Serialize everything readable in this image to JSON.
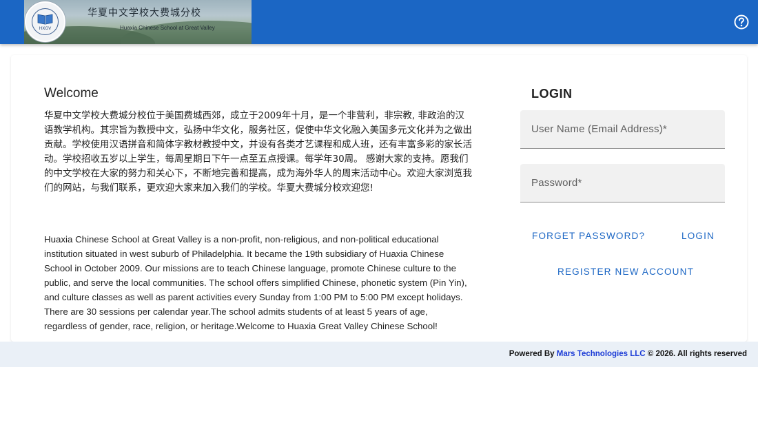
{
  "header": {
    "banner_cn_title": "华夏中文学校大费城分校",
    "banner_en_title": "Huaxia Chinese School at Great Valley",
    "seal_code": "HXGV",
    "help_icon": "help-circle-icon",
    "colors": {
      "appbar": "#1b66c4"
    }
  },
  "welcome": {
    "title": "Welcome",
    "zh_paragraph": "华夏中文学校大费城分校位于美国费城西郊，成立于2009年十月，是一个非营利，非宗教, 非政治的汉语教学机构。其宗旨为教授中文，弘扬中华文化，服务社区，促使中华文化融入美国多元文化并为之做出贡献。学校使用汉语拼音和简体字教材教授中文，并设有各类才艺课程和成人班，还有丰富多彩的家长活动。学校招收五岁以上学生，每周星期日下午一点至五点授课。每学年30周。 感谢大家的支持。愿我们的中文学校在大家的努力和关心下，不断地完善和提高，成为海外华人的周末活动中心。欢迎大家浏览我们的网站，与我们联系，更欢迎大家来加入我们的学校。华夏大费城分校欢迎您!",
    "en_paragraph": "Huaxia Chinese School at Great Valley is a non-profit, non-religious, and non-political educational institution situated in west suburb of Philadelphia. It became the 19th subsidiary of Huaxia Chinese School in October 2009. Our missions are to teach Chinese language, promote Chinese culture to the public, and serve the local communities. The school offers simplified Chinese, phonetic system (Pin Yin), and culture classes as well as parent activities every Sunday from 1:00 PM to 5:00 PM except holidays. There are 30 sessions per calendar year.The school admits students of at least 5 years of age, regardless of gender, race, religion, or heritage.Welcome to Huaxia Great Valley Chinese School!"
  },
  "login": {
    "title": "LOGIN",
    "username_placeholder": "User Name (Email Address)*",
    "password_placeholder": "Password*",
    "forget_password_label": "FORGET PASSWORD?",
    "login_button_label": "LOGIN",
    "register_label": "REGISTER NEW ACCOUNT",
    "colors": {
      "accent": "#1b66c4"
    }
  },
  "footer": {
    "powered_by": "Powered By",
    "company": "Mars Technologies LLC",
    "rights": "© 2026. All rights reserved"
  }
}
